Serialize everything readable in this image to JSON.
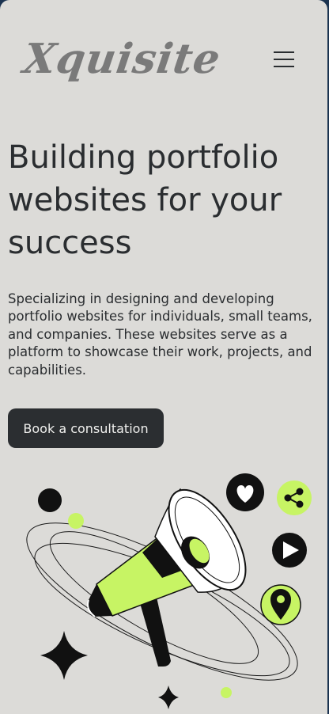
{
  "header": {
    "logo_text": "Xquisite",
    "menu_icon": "hamburger-menu-icon"
  },
  "hero": {
    "headline_lines": [
      "Building portfolio",
      "websites for your",
      "success"
    ],
    "description": "Specializing in designing and developing portfolio websites for individuals, small teams, and companies. These websites serve as a platform to showcase their work, projects, and capabilities.",
    "cta_label": "Book a consultation"
  },
  "illustration": {
    "icons": [
      "megaphone-icon",
      "heart-icon",
      "share-icon",
      "play-icon",
      "location-pin-icon",
      "sparkle-icon"
    ],
    "colors": {
      "accent": "#c7f464",
      "dark": "#111111",
      "background": "#dcdbd8",
      "text": "#2a2d30",
      "frame": "#1b3350"
    }
  }
}
